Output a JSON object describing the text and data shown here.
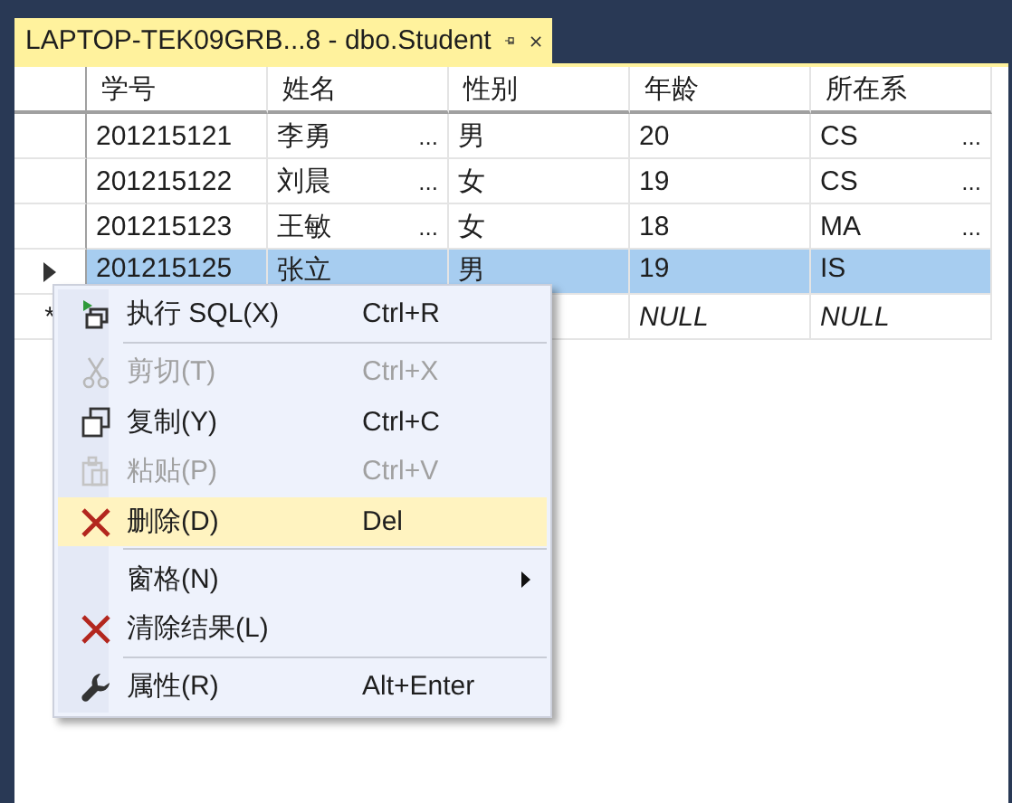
{
  "tab": {
    "title": "LAPTOP-TEK09GRB...8 - dbo.Student",
    "selected": true
  },
  "table": {
    "columns": [
      "学号",
      "姓名",
      "性别",
      "年龄",
      "所在系"
    ],
    "rows": [
      {
        "current": false,
        "selected": false,
        "cells": [
          {
            "text": "201215121"
          },
          {
            "text": "李勇",
            "more": "..."
          },
          {
            "text": "男"
          },
          {
            "text": "20"
          },
          {
            "text": "CS",
            "more": "..."
          }
        ]
      },
      {
        "current": false,
        "selected": false,
        "cells": [
          {
            "text": "201215122"
          },
          {
            "text": "刘晨",
            "more": "..."
          },
          {
            "text": "女"
          },
          {
            "text": "19"
          },
          {
            "text": "CS",
            "more": "..."
          }
        ]
      },
      {
        "current": false,
        "selected": false,
        "cells": [
          {
            "text": "201215123"
          },
          {
            "text": "王敏",
            "more": "..."
          },
          {
            "text": "女"
          },
          {
            "text": "18"
          },
          {
            "text": "MA",
            "more": "..."
          }
        ]
      },
      {
        "current": true,
        "selected": true,
        "cells": [
          {
            "text": "201215125"
          },
          {
            "text": "张立"
          },
          {
            "text": "男"
          },
          {
            "text": "19"
          },
          {
            "text": "IS"
          }
        ]
      }
    ],
    "new_row": {
      "marker": "*",
      "cells": [
        null,
        null,
        null,
        {
          "text": "NULL"
        },
        {
          "text": "NULL"
        }
      ]
    }
  },
  "context_menu": [
    {
      "kind": "item",
      "label": "执行 SQL(X)",
      "shortcut": "Ctrl+R",
      "submenu": false,
      "disabled": false,
      "selected": false
    },
    {
      "kind": "separator"
    },
    {
      "kind": "item",
      "label": "剪切(T)",
      "shortcut": "Ctrl+X",
      "submenu": false,
      "disabled": true,
      "selected": false
    },
    {
      "kind": "item",
      "label": "复制(Y)",
      "shortcut": "Ctrl+C",
      "submenu": false,
      "disabled": false,
      "selected": false
    },
    {
      "kind": "item",
      "label": "粘贴(P)",
      "shortcut": "Ctrl+V",
      "submenu": false,
      "disabled": true,
      "selected": false
    },
    {
      "kind": "item",
      "label": "删除(D)",
      "shortcut": "Del",
      "submenu": false,
      "disabled": false,
      "selected": true
    },
    {
      "kind": "separator"
    },
    {
      "kind": "item",
      "label": "窗格(N)",
      "submenu": true,
      "disabled": false,
      "selected": false
    },
    {
      "kind": "item",
      "label": "清除结果(L)",
      "submenu": false,
      "disabled": false,
      "selected": false
    },
    {
      "kind": "separator"
    },
    {
      "kind": "item",
      "label": "属性(R)",
      "shortcut": "Alt+Enter",
      "submenu": false,
      "disabled": false,
      "selected": false
    }
  ]
}
